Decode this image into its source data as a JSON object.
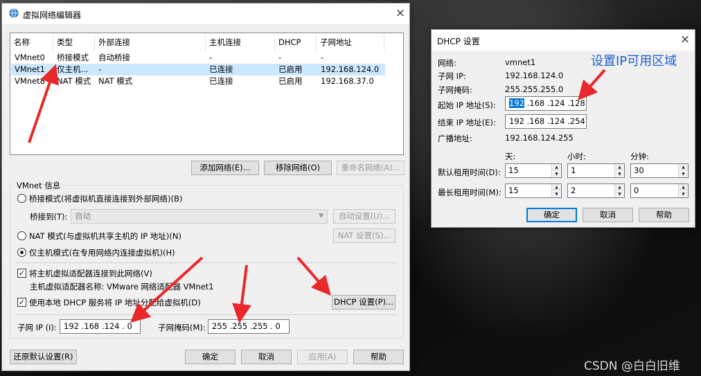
{
  "main_window": {
    "title": "虚拟网络编辑器",
    "close": "×",
    "columns": [
      "名称",
      "类型",
      "外部连接",
      "主机连接",
      "DHCP",
      "子网地址"
    ],
    "rows": [
      {
        "name": "VMnet0",
        "type": "桥接模式",
        "external": "自动桥接",
        "host": "-",
        "dhcp": "-",
        "subnet": "-"
      },
      {
        "name": "VMnet1",
        "type": "仅主机...",
        "external": "-",
        "host": "已连接",
        "dhcp": "已启用",
        "subnet": "192.168.124.0"
      },
      {
        "name": "VMnet8",
        "type": "NAT 模式",
        "external": "NAT 模式",
        "host": "已连接",
        "dhcp": "已启用",
        "subnet": "192.168.37.0"
      }
    ],
    "add_network": "添加网络(E)...",
    "remove_network": "移除网络(O)",
    "rename_network": "重命名网络(A)...",
    "vmnet_info": "VMnet 信息",
    "bridge_mode": "桥接模式(将虚拟机直接连接到外部网络)(B)",
    "bridge_to_label": "桥接到(T):",
    "bridge_to_value": "自动",
    "auto_settings": "自动设置(U)...",
    "nat_mode": "NAT 模式(与虚拟机共享主机的 IP 地址)(N)",
    "nat_settings": "NAT 设置(S)...",
    "host_only_mode": "仅主机模式(在专用网络内连接虚拟机)(H)",
    "connect_adapter": "将主机虚拟适配器连接到此网络(V)",
    "adapter_name": "主机虚拟适配器名称: VMware 网络适配器 VMnet1",
    "use_dhcp": "使用本地 DHCP 服务将 IP 地址分配给虚拟机(D)",
    "dhcp_settings": "DHCP 设置(P)...",
    "subnet_ip_label": "子网 IP (I):",
    "subnet_ip_value": "192 .168 .124 . 0",
    "subnet_mask_label": "子网掩码(M):",
    "subnet_mask_value": "255 .255 .255 . 0",
    "restore_defaults": "还原默认设置(R)",
    "ok": "确定",
    "cancel": "取消",
    "apply": "应用(A)",
    "help": "帮助"
  },
  "dhcp_window": {
    "title": "DHCP 设置",
    "close": "×",
    "network_label": "网络:",
    "network_value": "vmnet1",
    "subnet_ip_label": "子网 IP:",
    "subnet_ip_value": "192.168.124.0",
    "subnet_mask_label": "子网掩码:",
    "subnet_mask_value": "255.255.255.0",
    "start_ip_label": "起始 IP 地址(S):",
    "start_ip_highlight": "192",
    "start_ip_rest": " .168 .124 .128",
    "end_ip_label": "结束 IP 地址(E):",
    "end_ip_value": "192 .168 .124 .254",
    "broadcast_label": "广播地址:",
    "broadcast_value": "192.168.124.255",
    "days_header": "天:",
    "hours_header": "小时:",
    "minutes_header": "分钟:",
    "default_lease_label": "默认租用时间(D):",
    "default_lease": {
      "days": "15",
      "hours": "1",
      "minutes": "30"
    },
    "max_lease_label": "最长租用时间(M):",
    "max_lease": {
      "days": "15",
      "hours": "2",
      "minutes": "0"
    },
    "ok": "确定",
    "cancel": "取消",
    "help": "帮助"
  },
  "annotation": "设置IP可用区域",
  "watermark": "CSDN @白白旧维",
  "colors": {
    "annotation_red": "#e8282a",
    "annotation_blue": "#2060d0",
    "selection": "#cce8ff"
  }
}
